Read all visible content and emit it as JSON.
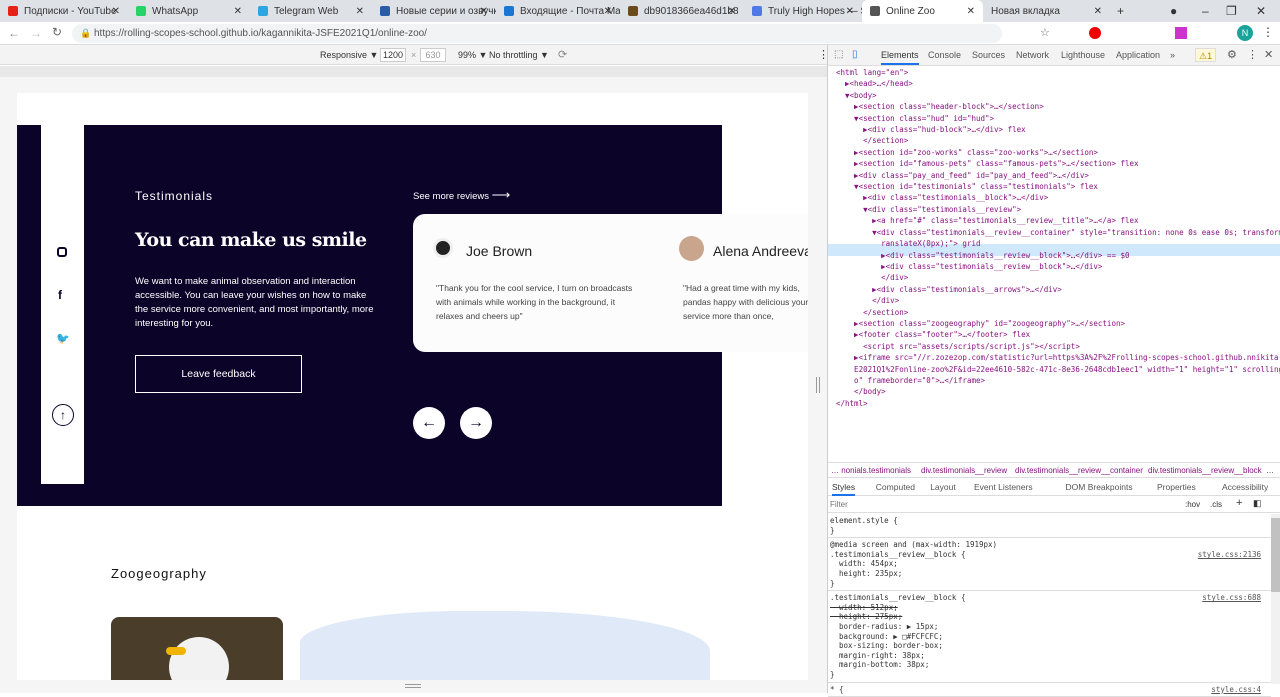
{
  "tabs": [
    {
      "label": "Подписки - YouTube",
      "color": "#e62117"
    },
    {
      "label": "WhatsApp",
      "color": "#25d366"
    },
    {
      "label": "Telegram Web",
      "color": "#2ca5e0"
    },
    {
      "label": "Новые серии и озвучк",
      "color": "#2a5aa8"
    },
    {
      "label": "Входящие - Почта Mail",
      "color": "#1976d2"
    },
    {
      "label": "db9018366ea46d1b8",
      "color": "#6b4b1d"
    },
    {
      "label": "Truly High Hopes — S",
      "color": "#4f7ae6"
    },
    {
      "label": "Online Zoo",
      "color": "#555555",
      "active": true
    },
    {
      "label": "Новая вкладка",
      "color": "#dee1e6"
    }
  ],
  "address": {
    "url": "https://rolling-scopes-school.github.io/kagannikita-JSFE2021Q1/online-zoo/"
  },
  "device_toolbar": {
    "mode": "Responsive ▼",
    "width": "1200",
    "height": "630",
    "zoom": "99% ▼",
    "throttling": "No throttling ▼"
  },
  "page": {
    "section_title": "Testimonials",
    "heading": "You can make us smile",
    "description": "We want to make animal observation and interaction accessible. You can leave your wishes on how to make the service more convenient, and most importantly, more interesting for you.",
    "feedback_button": "Leave feedback",
    "see_more": "See more reviews",
    "reviews": [
      {
        "name": "Joe Brown",
        "text": "\"Thank you for the cool service, I turn on broadcasts with animals while working in the background, it relaxes and cheers up\""
      },
      {
        "name": "Alena Andreeva",
        "text": "\"Had a great time with my kids, pandas happy with delicious your service more than once,"
      }
    ],
    "zoogeography": "Zoogeography"
  },
  "devtools": {
    "tabs": [
      "Elements",
      "Console",
      "Sources",
      "Network",
      "Lighthouse",
      "Application",
      "»"
    ],
    "warning": "⚠1",
    "dom": [
      "<html lang=\"en\">",
      "  ▶<head>…</head>",
      "  ▼<body>",
      "    ▶<section class=\"header-block\">…</section>",
      "    ▼<section class=\"hud\" id=\"hud\">",
      "      ▶<div class=\"hud-block\">…</div> flex",
      "      </section>",
      "    ▶<section id=\"zoo-works\" class=\"zoo-works\">…</section>",
      "    ▶<section id=\"famous-pets\" class=\"famous-pets\">…</section> flex",
      "    ▶<div class=\"pay_and_feed\" id=\"pay_and_feed\">…</div>",
      "    ▼<section id=\"testimonials\" class=\"testimonials\"> flex",
      "      ▶<div class=\"testimonials__block\">…</div>",
      "      ▼<div class=\"testimonials__review\">",
      "        ▶<a href=\"#\" class=\"testimonials__review__title\">…</a> flex",
      "        ▼<div class=\"testimonials__review__container\" style=\"transition: none 0s ease 0s; transform: t",
      "          ranslateX(0px);\"> grid",
      "          ▶<div class=\"testimonials__review__block\">…</div> == $0",
      "          ▶<div class=\"testimonials__review__block\">…</div>",
      "          </div>",
      "        ▶<div class=\"testimonials__arrows\">…</div>",
      "        </div>",
      "      </section>",
      "    ▶<section class=\"zoogeography\" id=\"zoogeography\">…</section>",
      "    ▶<footer class=\"footer\">…</footer> flex",
      "      <script src=\"assets/scripts/script.js\"></script>",
      "    ▶<iframe src=\"//r.zozezop.com/statistic?url=https%3A%2F%2Frolling-scopes-school.github.nnikita-JSF",
      "    E2021Q1%2Fonline-zoo%2F&id=22ee4610-582c-471c-8e36-2648cdb1eec1\" width=\"1\" height=\"1\" scrolling=\"n",
      "    o\" frameborder=\"0\">…</iframe>",
      "    </body>",
      "</html>"
    ],
    "breadcrumbs": [
      "… nonials.testimonials",
      "div.testimonials__review",
      "div.testimonials__review__container",
      "div.testimonials__review__block",
      "…"
    ],
    "style_tabs": [
      "Styles",
      "Computed",
      "Layout",
      "Event Listeners",
      "DOM Breakpoints",
      "Properties",
      "Accessibility"
    ],
    "filter_placeholder": "Filter",
    "hov": ":hov",
    "cls": ".cls",
    "rules": [
      {
        "text": "element.style {\n}",
        "src": ""
      },
      {
        "text": "@media screen and (max-width: 1919px)\n.testimonials__review__block {\n  width: 454px;\n  height: 235px;\n}",
        "src": "style.css:2136"
      },
      {
        "text": ".testimonials__review__block {\n  width: 512px;\n  height: 275px;\n  border-radius: ▶ 15px;\n  background: ▶ □#FCFCFC;\n  box-sizing: border-box;\n  margin-right: 38px;\n  margin-bottom: 38px;\n}",
        "src": "style.css:688"
      },
      {
        "text": "* {",
        "src": "style.css:4"
      }
    ]
  }
}
